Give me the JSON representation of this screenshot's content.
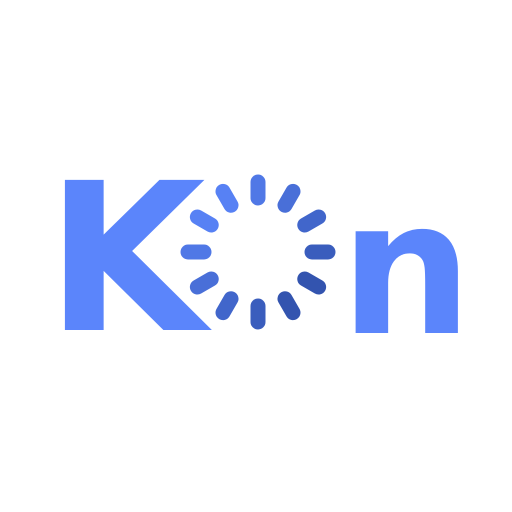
{
  "logo": {
    "letters": {
      "first": "K",
      "last": "n"
    },
    "text_color": "#5b85fb",
    "spinner": {
      "name": "loading-spinner-icon",
      "spokes": 12,
      "color_light": "#5b85fb",
      "color_dark": "#2f4fa8"
    }
  }
}
